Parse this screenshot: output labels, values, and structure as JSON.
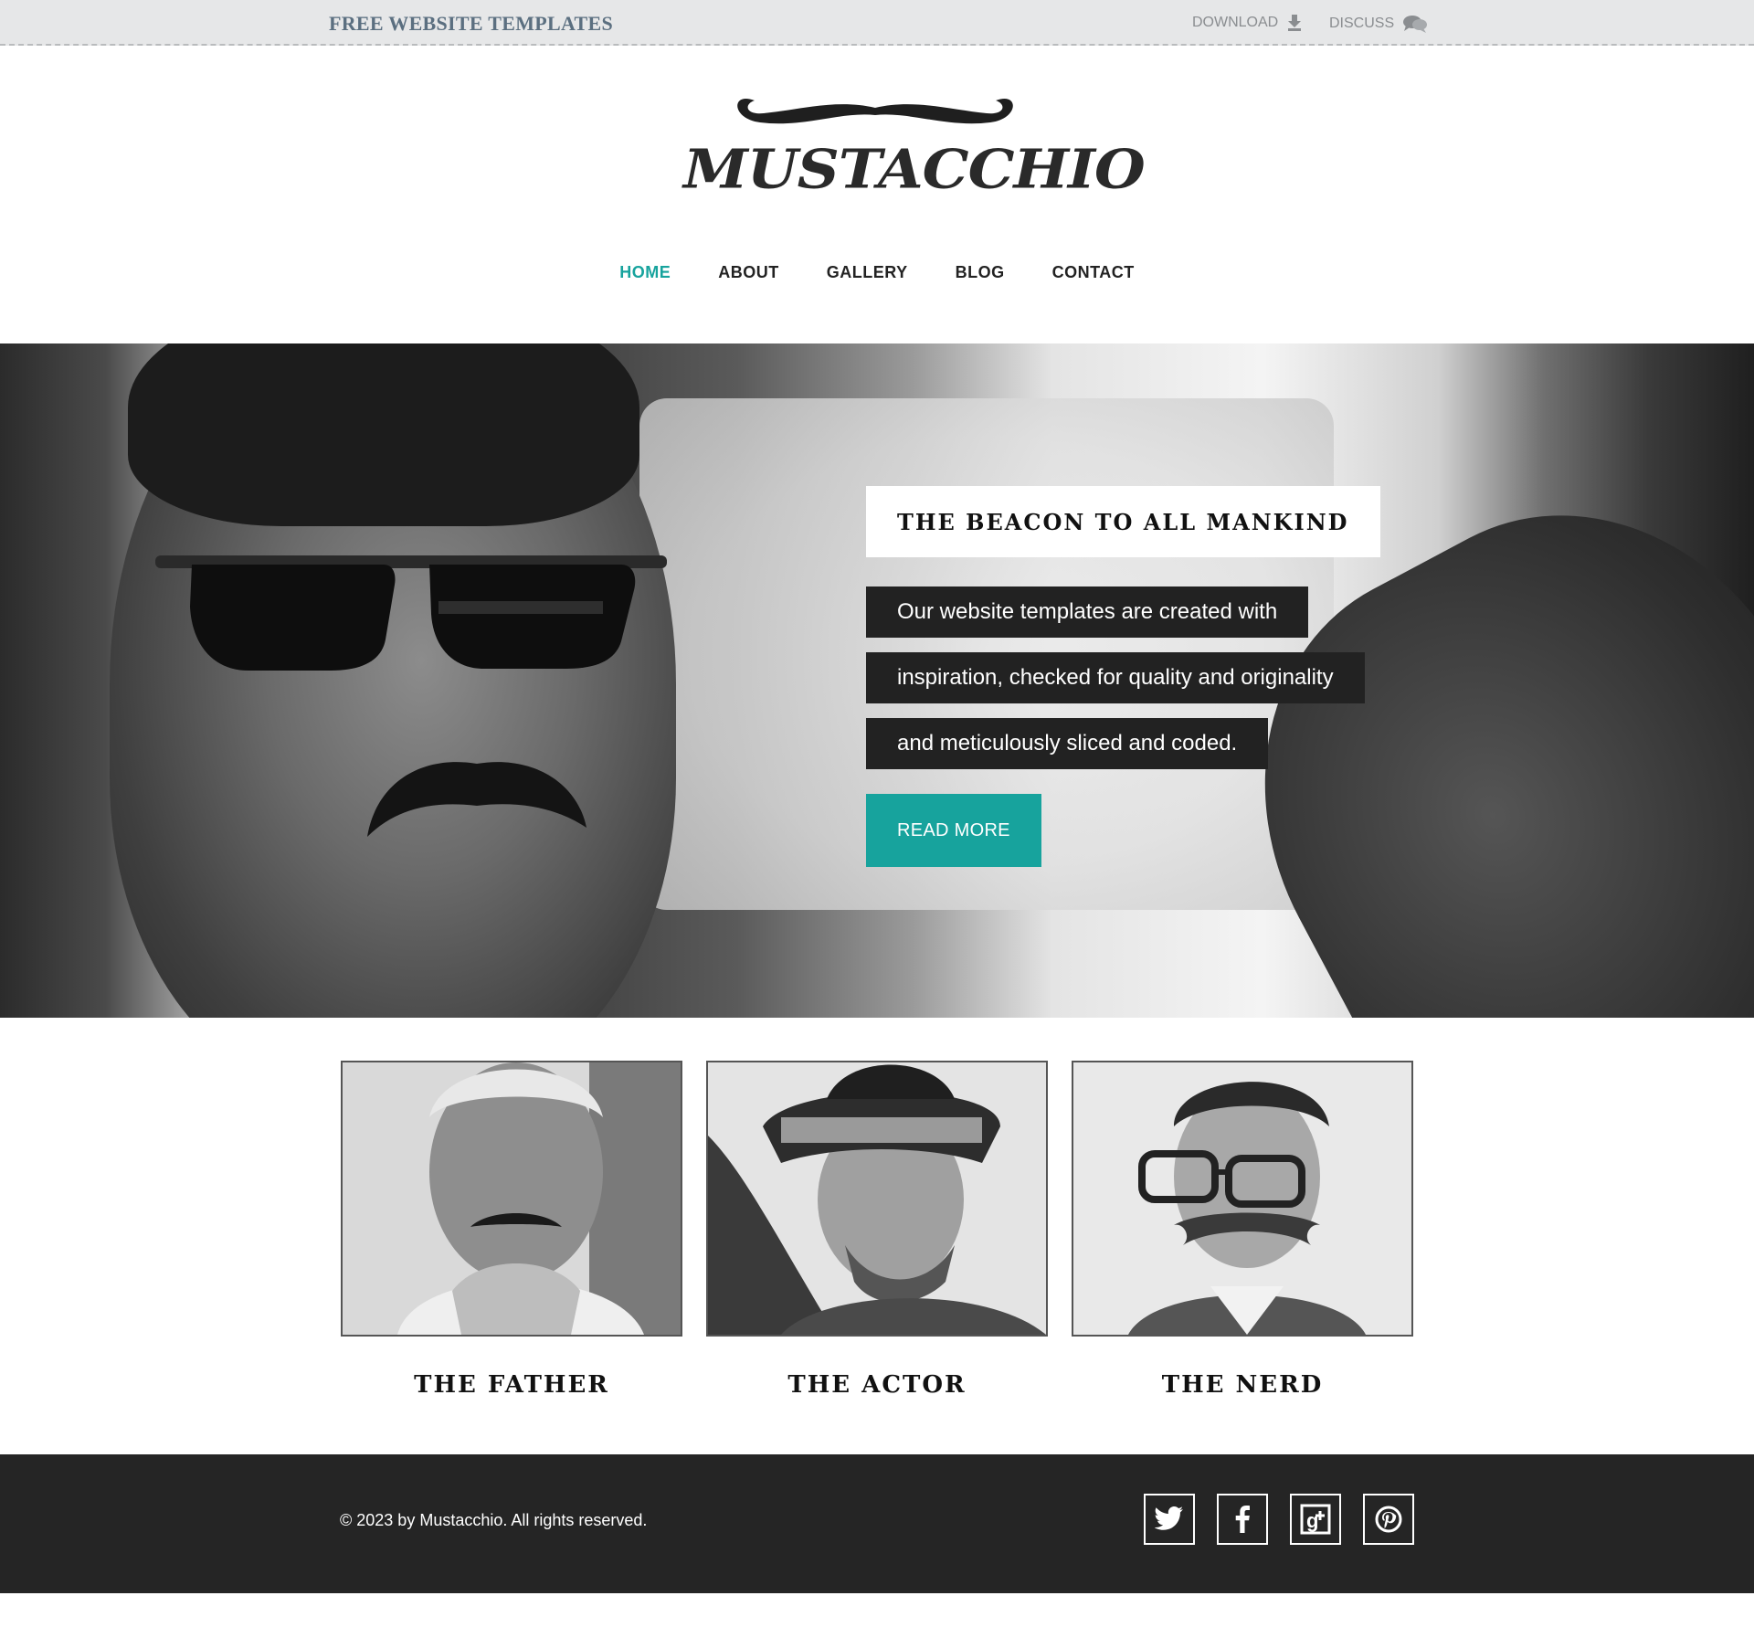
{
  "topbar": {
    "brand": "FREE WEBSITE TEMPLATES",
    "download_label": "DOWNLOAD",
    "discuss_label": "DISCUSS"
  },
  "logo": {
    "text": "MUSTACCHIO"
  },
  "nav": {
    "items": [
      {
        "label": "HOME",
        "active": true
      },
      {
        "label": "ABOUT",
        "active": false
      },
      {
        "label": "GALLERY",
        "active": false
      },
      {
        "label": "BLOG",
        "active": false
      },
      {
        "label": "CONTACT",
        "active": false
      }
    ]
  },
  "hero": {
    "title": "THE BEACON TO ALL MANKIND",
    "lines": [
      "Our website templates are created with",
      "inspiration, checked for quality and originality",
      "and meticulously sliced and coded."
    ],
    "button_label": "READ MORE"
  },
  "cards": [
    {
      "title": "THE FATHER"
    },
    {
      "title": "THE ACTOR"
    },
    {
      "title": "THE NERD"
    }
  ],
  "footer": {
    "copyright": "© 2023 by Mustacchio. All rights reserved.",
    "social": [
      "twitter-icon",
      "facebook-icon",
      "google-plus-icon",
      "pinterest-icon"
    ]
  },
  "colors": {
    "accent": "#17a39d",
    "topbar_bg": "#e6e7e8",
    "brand_text": "#5b6f80",
    "footer_bg": "#252525",
    "caption_bg": "#222222"
  }
}
